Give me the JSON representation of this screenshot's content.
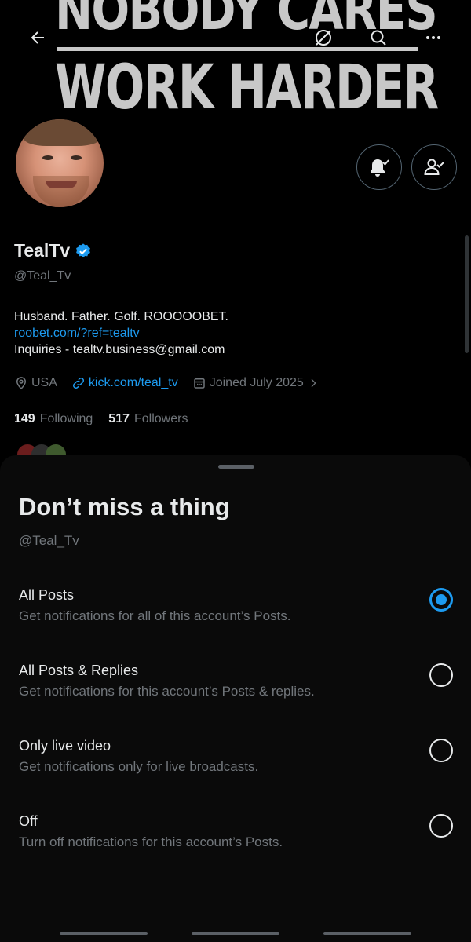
{
  "banner": {
    "line1": "NOBODY CARES",
    "line2": "WORK HARDER"
  },
  "header": {
    "icons": [
      "back-arrow-icon",
      "grok-icon",
      "search-icon",
      "more-icon"
    ]
  },
  "profile": {
    "name": "TealTv",
    "verified": true,
    "handle": "@Teal_Tv",
    "bio_line1": "Husband. Father. Golf. ROOOOOBET.",
    "bio_link": "roobet.com/?ref=tealtv",
    "bio_line3": "Inquiries - tealtv.business@gmail.com",
    "location": "USA",
    "website": "kick.com/teal_tv",
    "joined": "Joined July 2025",
    "following_count": "149",
    "following_label": "Following",
    "followers_count": "517",
    "followers_label": "Followers"
  },
  "sheet": {
    "title": "Don’t miss a thing",
    "handle": "@Teal_Tv",
    "selected_index": 0,
    "options": [
      {
        "title": "All Posts",
        "description": "Get notifications for all of this account’s Posts."
      },
      {
        "title": "All Posts & Replies",
        "description": "Get notifications for this account’s Posts & replies."
      },
      {
        "title": "Only live video",
        "description": "Get notifications only for live broadcasts."
      },
      {
        "title": "Off",
        "description": "Turn off notifications for this account’s Posts."
      }
    ]
  },
  "colors": {
    "accent": "#1d9bf0",
    "background": "#000000",
    "sheet_background": "#0a0a0a",
    "secondary_text": "#71767b",
    "primary_text": "#e7e9ea"
  }
}
